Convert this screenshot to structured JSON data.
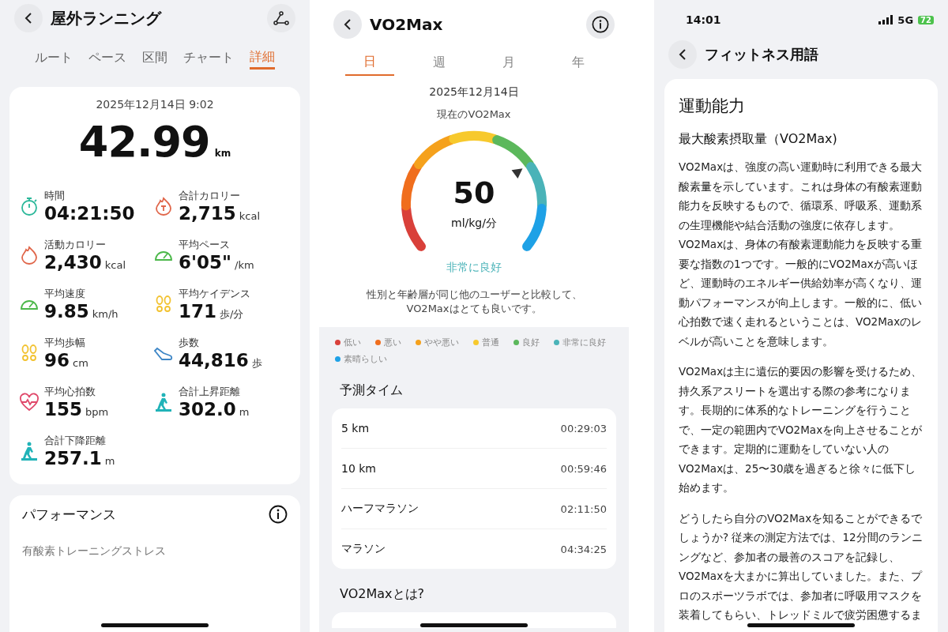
{
  "run_screen": {
    "title": "屋外ランニング",
    "tabs": [
      {
        "label": "ルート",
        "selected": false
      },
      {
        "label": "ペース",
        "selected": false
      },
      {
        "label": "区間",
        "selected": false
      },
      {
        "label": "チャート",
        "selected": false
      },
      {
        "label": "詳細",
        "selected": true
      }
    ],
    "date": "2025年12月14日 9:02",
    "distance": "42.99",
    "distance_unit": "km",
    "stats": [
      {
        "label": "時間",
        "value": "04:21:50",
        "kind": "stopwatch",
        "color": "#2bb89a"
      },
      {
        "label": "合計カロリー",
        "value": "2,715",
        "unit": "kcal",
        "kind": "flame-t",
        "color": "#e0664a"
      },
      {
        "label": "活動カロリー",
        "value": "2,430",
        "unit": "kcal",
        "kind": "flame",
        "color": "#e0664a"
      },
      {
        "label": "平均ペース",
        "value": "6'05\"",
        "unit": "/km",
        "kind": "gauge",
        "color": "#4cb84a"
      },
      {
        "label": "平均速度",
        "value": "9.85",
        "unit": "km/h",
        "kind": "gauge",
        "color": "#4cb84a"
      },
      {
        "label": "平均ケイデンス",
        "value": "171",
        "unit": "歩/分",
        "kind": "feet",
        "color": "#f2c230"
      },
      {
        "label": "平均歩幅",
        "value": "96",
        "unit": "cm",
        "kind": "feet",
        "color": "#f2c230"
      },
      {
        "label": "歩数",
        "value": "44,816",
        "unit": "歩",
        "kind": "shoe",
        "color": "#3d86c6"
      },
      {
        "label": "平均心拍数",
        "value": "155",
        "unit": "bpm",
        "kind": "heart",
        "color": "#e0486a"
      },
      {
        "label": "合計上昇距離",
        "value": "302.0",
        "unit": "m",
        "kind": "hiker",
        "color": "#21b3b8"
      },
      {
        "label": "合計下降距離",
        "value": "257.1",
        "unit": "m",
        "kind": "hiker",
        "color": "#21b3b8"
      }
    ],
    "performance": {
      "title": "パフォーマンス",
      "first_item": "有酸素トレーニングストレス"
    }
  },
  "vo2_screen": {
    "title": "VO2Max",
    "tabs": [
      {
        "label": "日",
        "selected": true
      },
      {
        "label": "週",
        "selected": false
      },
      {
        "label": "月",
        "selected": false
      },
      {
        "label": "年",
        "selected": false
      }
    ],
    "date": "2025年12月14日",
    "caption": "現在のVO2Max",
    "value": "50",
    "unit": "ml/kg/分",
    "rating": "非常に良好",
    "description": [
      "性別と年齢層が同じ他のユーザーと比較して、",
      "VO2Maxはとても良いです。"
    ],
    "legend": [
      {
        "label": "低い",
        "color": "#d9403a"
      },
      {
        "label": "悪い",
        "color": "#f06e1d"
      },
      {
        "label": "やや悪い",
        "color": "#f5a11c"
      },
      {
        "label": "普通",
        "color": "#f7c92d"
      },
      {
        "label": "良好",
        "color": "#5cb85c"
      },
      {
        "label": "非常に良好",
        "color": "#4ab3b8"
      },
      {
        "label": "素晴らしい",
        "color": "#1ea1e6"
      }
    ],
    "predicted_title": "予測タイム",
    "predictions": [
      {
        "race": "5 km",
        "time": "00:29:03"
      },
      {
        "race": "10 km",
        "time": "00:59:46"
      },
      {
        "race": "ハーフマラソン",
        "time": "02:11:50"
      },
      {
        "race": "マラソン",
        "time": "04:34:25"
      }
    ],
    "about_title": "VO2Maxとは?"
  },
  "glossary_screen": {
    "status_bar": {
      "time": "14:01",
      "network": "5G",
      "battery": "72"
    },
    "title": "フィットネス用語",
    "heading": "運動能力",
    "subheading": "最大酸素摂取量（VO2Max)",
    "blocks": [
      [
        "VO2Maxは、強度の高い運動時に利用できる最大酸素量を示しています。これは身体の有酸素運動能力を反映するもので、循環系、呼吸系、運動系の生理機能や結合活動の強度に依存します。",
        "VO2Maxは、身体の有酸素運動能力を反映する重要な指数の1つです。一般的にVO2Maxが高いほど、運動時のエネルギー供給効率が高くなり、運動パフォーマンスが向上します。一般的に、低い心拍数で速く走れるということは、VO2Maxのレベルが高いことを意味します。"
      ],
      [
        "VO2Maxは主に遺伝的要因の影響を受けるため、持久系アスリートを選出する際の参考になります。長期的に体系的なトレーニングを行うことで、一定の範囲内でVO2Maxを向上させることができます。定期的に運動をしていない人のVO2Maxは、25〜30歳を過ぎると徐々に低下し始めます。"
      ],
      [
        "どうしたら自分のVO2Maxを知ることができるでしょうか? 従来の測定方法では、12分間のランニングなど、参加者の最善のスコアを記録し、VO2Maxを大まかに算出していました。また、プロのスポーツラボでは、参加者に呼吸用マスクを装着してもらい、トレッドミルで疲労困憊するま"
      ]
    ]
  }
}
